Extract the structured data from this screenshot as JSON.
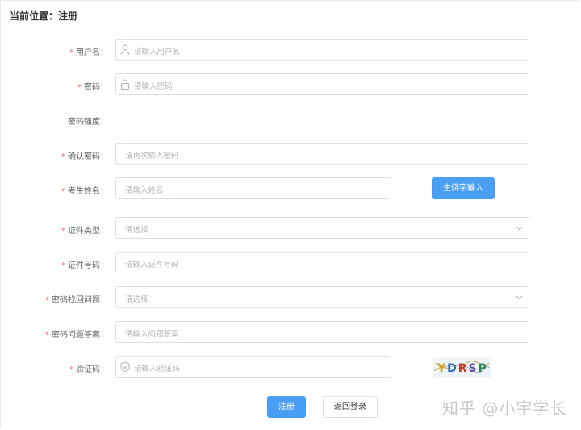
{
  "header": {
    "title": "当前位置：注册"
  },
  "form": {
    "username": {
      "label": "用户名：",
      "placeholder": "请输入用户名"
    },
    "password": {
      "label": "密码：",
      "placeholder": "请输入密码"
    },
    "strength": {
      "label": "密码强度："
    },
    "confirm": {
      "label": "确认密码：",
      "placeholder": "请再次输入密码"
    },
    "name": {
      "label": "考生姓名：",
      "placeholder": "请输入姓名",
      "button": "生僻字输入"
    },
    "id_type": {
      "label": "证件类型：",
      "placeholder": "请选择"
    },
    "id_number": {
      "label": "证件号码：",
      "placeholder": "请输入证件号码"
    },
    "question": {
      "label": "密码找回问题：",
      "placeholder": "请选择"
    },
    "answer": {
      "label": "密码问题答案：",
      "placeholder": "请输入问题答案"
    },
    "captcha": {
      "label": "验证码：",
      "placeholder": "请输入验证码",
      "image_text": "YDRSP"
    },
    "required_mark": "*"
  },
  "actions": {
    "register": "注册",
    "back_login": "返回登录"
  },
  "watermark": "知乎 @小宇学长",
  "colors": {
    "primary": "#409eff",
    "required": "#f56c6c",
    "border": "#dcdfe6"
  }
}
